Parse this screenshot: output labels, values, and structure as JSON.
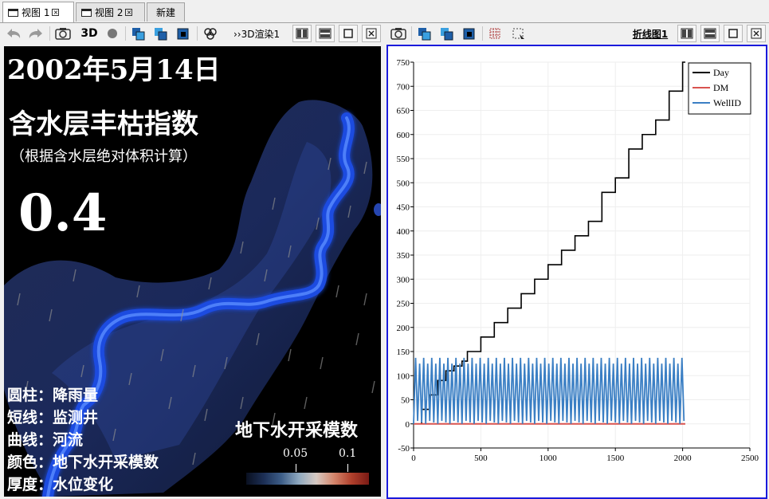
{
  "tabs": [
    {
      "label": "视图 1",
      "active": true,
      "closable": true
    },
    {
      "label": "视图 2",
      "active": false,
      "closable": true
    },
    {
      "label": "新建",
      "active": false,
      "closable": false
    }
  ],
  "toolbar": {
    "left_3d_label": "3D",
    "render_label": "››3D渲染1",
    "chart_label": "折线图1"
  },
  "view3d": {
    "date": "2002年5月14日",
    "index_title": "含水层丰枯指数",
    "index_subtitle": "（根据含水层绝对体积计算）",
    "index_value": "0.4",
    "legend_lines": [
      {
        "key": "圆柱：",
        "value": "降雨量"
      },
      {
        "key": "短线：",
        "value": "监测井"
      },
      {
        "key": "曲线：",
        "value": "河流"
      },
      {
        "key": "颜色：",
        "value": "地下水开采模数"
      },
      {
        "key": "厚度：",
        "value": "水位变化"
      }
    ],
    "colorbar_title": "地下水开采模数",
    "colorbar_ticks": [
      "0.05",
      "0.1"
    ]
  },
  "chart_data": {
    "type": "line",
    "xlim": [
      0,
      2500
    ],
    "ylim": [
      -50,
      750
    ],
    "x_ticks": [
      "0",
      "500",
      "1000",
      "1500",
      "2000",
      "2500"
    ],
    "y_ticks": [
      "-50",
      "0",
      "50",
      "100",
      "150",
      "200",
      "250",
      "300",
      "350",
      "400",
      "450",
      "500",
      "550",
      "600",
      "650",
      "700",
      "750"
    ],
    "grid": true,
    "legend_position": "top-right",
    "series": [
      {
        "name": "Day",
        "color": "#000000",
        "shape": "step",
        "x": [
          0,
          60,
          120,
          180,
          240,
          300,
          360,
          400,
          500,
          600,
          700,
          800,
          900,
          1000,
          1100,
          1200,
          1300,
          1400,
          1500,
          1600,
          1700,
          1800,
          1900,
          2000
        ],
        "y": [
          0,
          30,
          60,
          90,
          110,
          120,
          130,
          150,
          180,
          210,
          240,
          270,
          300,
          330,
          360,
          390,
          420,
          480,
          510,
          570,
          600,
          630,
          690,
          750
        ]
      },
      {
        "name": "DM",
        "color": "#d9534f",
        "x": [
          0,
          2020
        ],
        "y": [
          0,
          0
        ]
      },
      {
        "name": "WellID",
        "color": "#3b7fc4",
        "shape": "oscillating",
        "x_range": [
          0,
          2020
        ],
        "y_range": [
          0,
          143
        ],
        "period": 30
      }
    ]
  }
}
